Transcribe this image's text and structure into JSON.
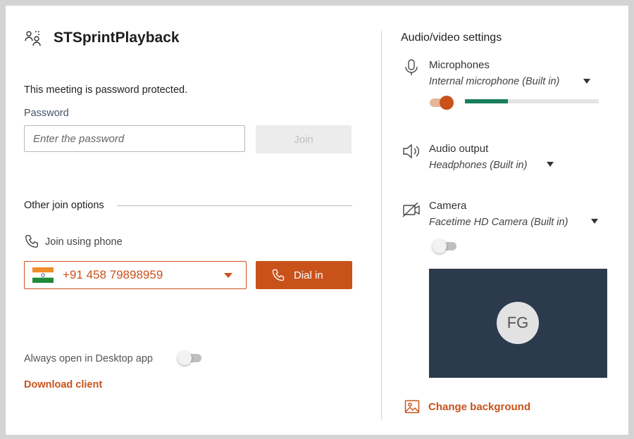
{
  "meeting": {
    "title": "STSprintPlayback",
    "protected_text": "This meeting is password protected.",
    "password_label": "Password",
    "password_placeholder": "Enter the password",
    "password_value": "",
    "join_label": "Join"
  },
  "join_options": {
    "heading": "Other join options",
    "phone_label": "Join using phone",
    "country_flag": "india-flag",
    "phone_number": "+91 458 79898959",
    "dial_label": "Dial in",
    "desktop_label": "Always open in Desktop app",
    "desktop_toggle_on": false,
    "download_label": "Download client"
  },
  "av_settings": {
    "title": "Audio/video settings",
    "microphone": {
      "label": "Microphones",
      "value": "Internal microphone (Built in)",
      "toggle_on": true,
      "level_fraction": 0.32
    },
    "audio_output": {
      "label": "Audio output",
      "value": "Headphones (Built in)"
    },
    "camera": {
      "label": "Camera",
      "value": "Facetime HD Camera (Built in)",
      "toggle_on": false
    },
    "preview_initials": "FG",
    "change_background_label": "Change background"
  },
  "colors": {
    "accent": "#c9521b",
    "level": "#1b7f5b",
    "preview_bg": "#2c3a4d"
  },
  "icons": [
    "participants-icon",
    "phone-icon",
    "microphone-icon",
    "speaker-icon",
    "camera-off-icon",
    "image-icon"
  ]
}
